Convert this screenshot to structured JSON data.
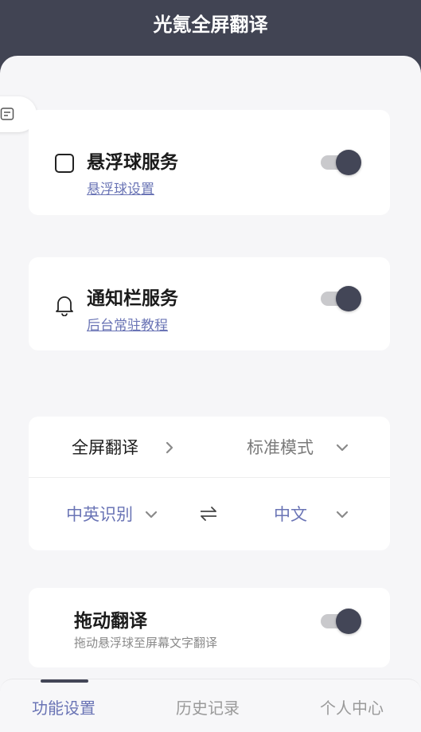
{
  "header": {
    "title": "光氪全屏翻译"
  },
  "colors": {
    "header_bg": "#414453",
    "accent": "#6a74b5",
    "toggle_knob": "#434657",
    "toggle_track": "#c9c9cc"
  },
  "float_service": {
    "title": "悬浮球服务",
    "link": "悬浮球设置",
    "toggle_on": true,
    "icon": "checkbox-square-icon"
  },
  "notification_service": {
    "title": "通知栏服务",
    "link": "后台常驻教程",
    "toggle_on": true,
    "icon": "bell-icon"
  },
  "translate_mode": {
    "label": "全屏翻译",
    "mode_value": "标准模式",
    "source_language": "中英识别",
    "target_language": "中文",
    "swap_icon": "swap-arrows-icon"
  },
  "drag_translate": {
    "title": "拖动翻译",
    "subtitle": "拖动悬浮球至屏幕文字翻译",
    "toggle_on": true
  },
  "bottom_nav": {
    "items": [
      {
        "label": "功能设置",
        "active": true
      },
      {
        "label": "历史记录",
        "active": false
      },
      {
        "label": "个人中心",
        "active": false
      }
    ]
  }
}
